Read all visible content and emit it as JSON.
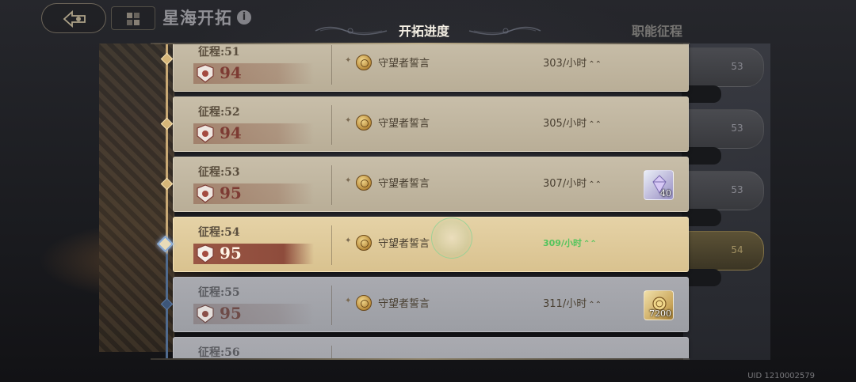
{
  "header": {
    "title": "星海开拓",
    "info_icon": "i",
    "tabs": [
      {
        "label": "开拓进度",
        "active": true
      },
      {
        "label": "职能征程",
        "active": false
      }
    ]
  },
  "side_panel": {
    "pins": [
      "53",
      "53",
      "53",
      "54"
    ]
  },
  "rows": [
    {
      "stage": "征程:51",
      "level": "94",
      "reward": "守望者誓言",
      "rate": "303/小时",
      "state": "done"
    },
    {
      "stage": "征程:52",
      "level": "94",
      "reward": "守望者誓言",
      "rate": "305/小时",
      "state": "done"
    },
    {
      "stage": "征程:53",
      "level": "95",
      "reward": "守望者誓言",
      "rate": "307/小时",
      "state": "done",
      "bonus": {
        "icon": "crystal-icon",
        "qty": "40"
      }
    },
    {
      "stage": "征程:54",
      "level": "95",
      "reward": "守望者誓言",
      "rate": "309/小时",
      "state": "current"
    },
    {
      "stage": "征程:55",
      "level": "95",
      "reward": "守望者誓言",
      "rate": "311/小时",
      "state": "locked",
      "bonus": {
        "icon": "coin-chest-icon",
        "qty": "7200"
      }
    },
    {
      "stage": "征程:56",
      "level": "",
      "reward": "",
      "rate": "",
      "state": "locked"
    }
  ],
  "footer": {
    "uid": "UID 1210002579"
  },
  "colors": {
    "accent_gold": "#c8a874",
    "current_rate": "#53c45c",
    "locked_line": "#4f6a8e"
  }
}
